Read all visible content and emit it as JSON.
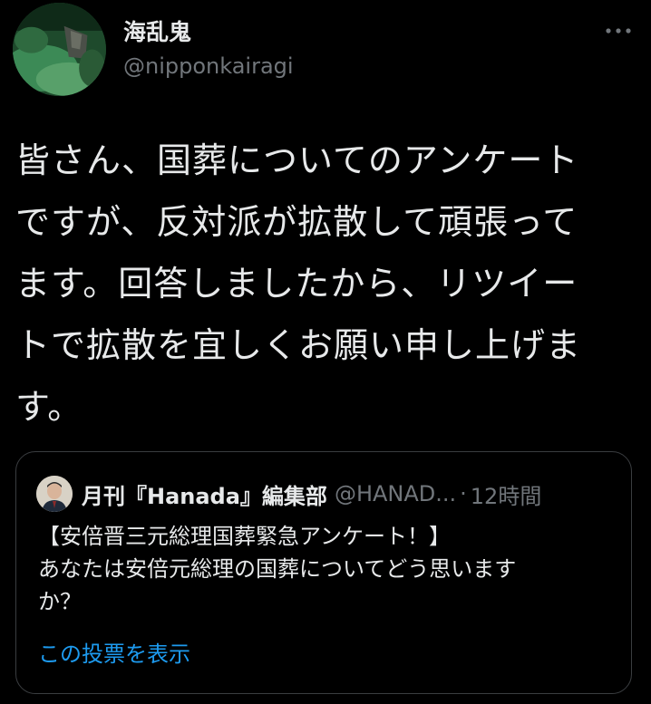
{
  "user": {
    "display_name": "海乱鬼",
    "handle": "@nipponkairagi"
  },
  "more_icon": "more-horizontal-icon",
  "tweet": {
    "lines": [
      "皆さん、国葬についてのアンケート",
      "ですが、反対派が拡散して頑張って",
      "ます。回答しましたから、リツイー",
      "トで拡散を宜しくお願い申し上げま",
      "す。"
    ]
  },
  "quote": {
    "name": "月刊『Hanada』編集部",
    "handle": "@HANAD...",
    "separator": "·",
    "time": "12時間",
    "lines": [
      "【安倍晋三元総理国葬緊急アンケート！】",
      "あなたは安倍元総理の国葬についてどう思います",
      "か？"
    ],
    "show_poll_label": "この投票を表示"
  },
  "colors": {
    "background": "#000000",
    "primary_text": "#e7e9ea",
    "secondary_text": "#71767b",
    "link": "#1d9bf0",
    "border": "#3a3d40"
  }
}
